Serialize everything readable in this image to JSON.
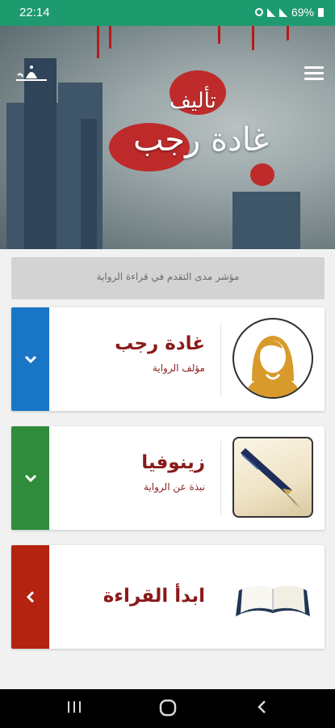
{
  "status_bar": {
    "time": "22:14",
    "battery_percent": "69%",
    "icons": [
      "alarm-icon",
      "signal-icon",
      "signal-icon",
      "battery-icon"
    ]
  },
  "header": {
    "subtitle": "تأليف",
    "author_name": "غادة رجب",
    "menu_icon": "menu-icon",
    "logo_icon": "app-logo-icon"
  },
  "progress": {
    "label": "مؤشر مدى التقدم في قراءة الرواية",
    "value": 0
  },
  "cards": [
    {
      "title": "غادة رجب",
      "subtitle": "مؤلف الرواية",
      "strip_color": "#1976c6",
      "icon": "chevron-down-icon",
      "image_icon": "author-avatar-icon"
    },
    {
      "title": "زينوفيا",
      "subtitle": "نبذة عن الرواية",
      "strip_color": "#2f8c3c",
      "icon": "chevron-down-icon",
      "image_icon": "fountain-pen-icon"
    },
    {
      "title": "ابدأ القراءة",
      "subtitle": "",
      "strip_color": "#b3230f",
      "icon": "chevron-left-icon",
      "image_icon": "open-book-icon"
    }
  ],
  "nav_bar": {
    "icons": [
      "recents-icon",
      "home-icon",
      "back-icon"
    ]
  },
  "colors": {
    "status_bar": "#1e9a6f",
    "title_text": "#8a1a1a",
    "progress_bg": "#d3d3d3"
  }
}
